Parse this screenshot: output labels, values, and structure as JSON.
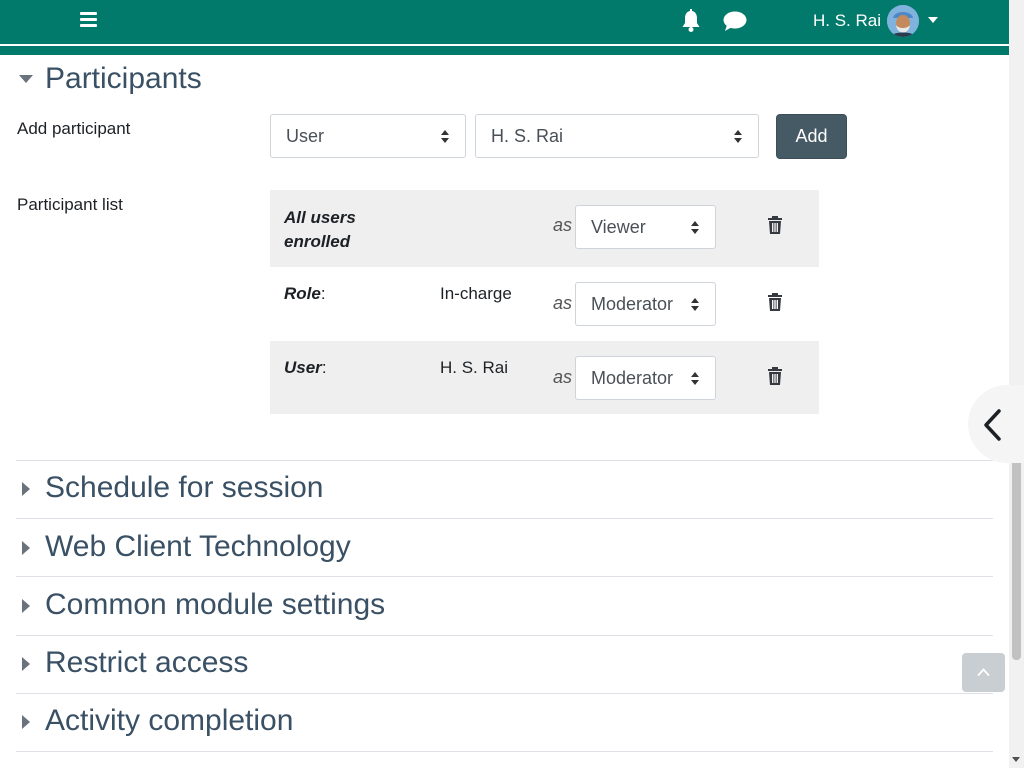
{
  "colors": {
    "brand": "#027a6b",
    "heading": "#3a5064",
    "button_dark": "#465a65"
  },
  "navbar": {
    "menu_icon": "hamburger-icon",
    "notification_icon": "bell-icon",
    "messages_icon": "chat-icon",
    "user_name": "H. S. Rai",
    "avatar": "user-avatar"
  },
  "participants": {
    "section_title": "Participants",
    "add_participant_label": "Add participant",
    "type_select": "User",
    "user_select": "H. S. Rai",
    "add_button": "Add",
    "list_label": "Participant list",
    "rows": [
      {
        "who": "All users enrolled",
        "who_line1": "All users",
        "who_line2": "enrolled",
        "suffix": "",
        "name": "",
        "as": "as",
        "role": "Viewer"
      },
      {
        "who": "Role",
        "suffix": ":",
        "name": "In-charge",
        "as": "as",
        "role": "Moderator"
      },
      {
        "who": "User",
        "suffix": ":",
        "name": "H. S. Rai",
        "as": "as",
        "role": "Moderator"
      }
    ]
  },
  "sections": [
    {
      "title": "Schedule for session"
    },
    {
      "title": "Web Client Technology"
    },
    {
      "title": "Common module settings"
    },
    {
      "title": "Restrict access"
    },
    {
      "title": "Activity completion"
    }
  ]
}
